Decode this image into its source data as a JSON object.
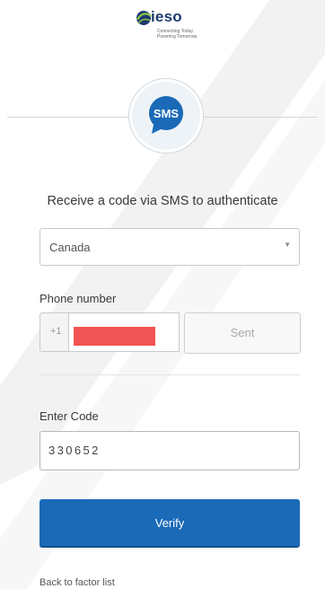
{
  "logo": {
    "word": "ieso",
    "tagline": "Connecting Today. Powering Tomorrow."
  },
  "badge": {
    "label": "SMS"
  },
  "heading": "Receive a code via SMS to authenticate",
  "country": {
    "selected": "Canada"
  },
  "phone": {
    "label": "Phone number",
    "prefix": "+1",
    "sent_label": "Sent"
  },
  "code": {
    "label": "Enter Code",
    "value": "330652"
  },
  "verify_label": "Verify",
  "back_link": "Back to factor list",
  "colors": {
    "primary": "#1a6ab8",
    "redaction": "#f25454",
    "logo_navy": "#1e3a6e",
    "logo_green": "#8bc34a"
  }
}
